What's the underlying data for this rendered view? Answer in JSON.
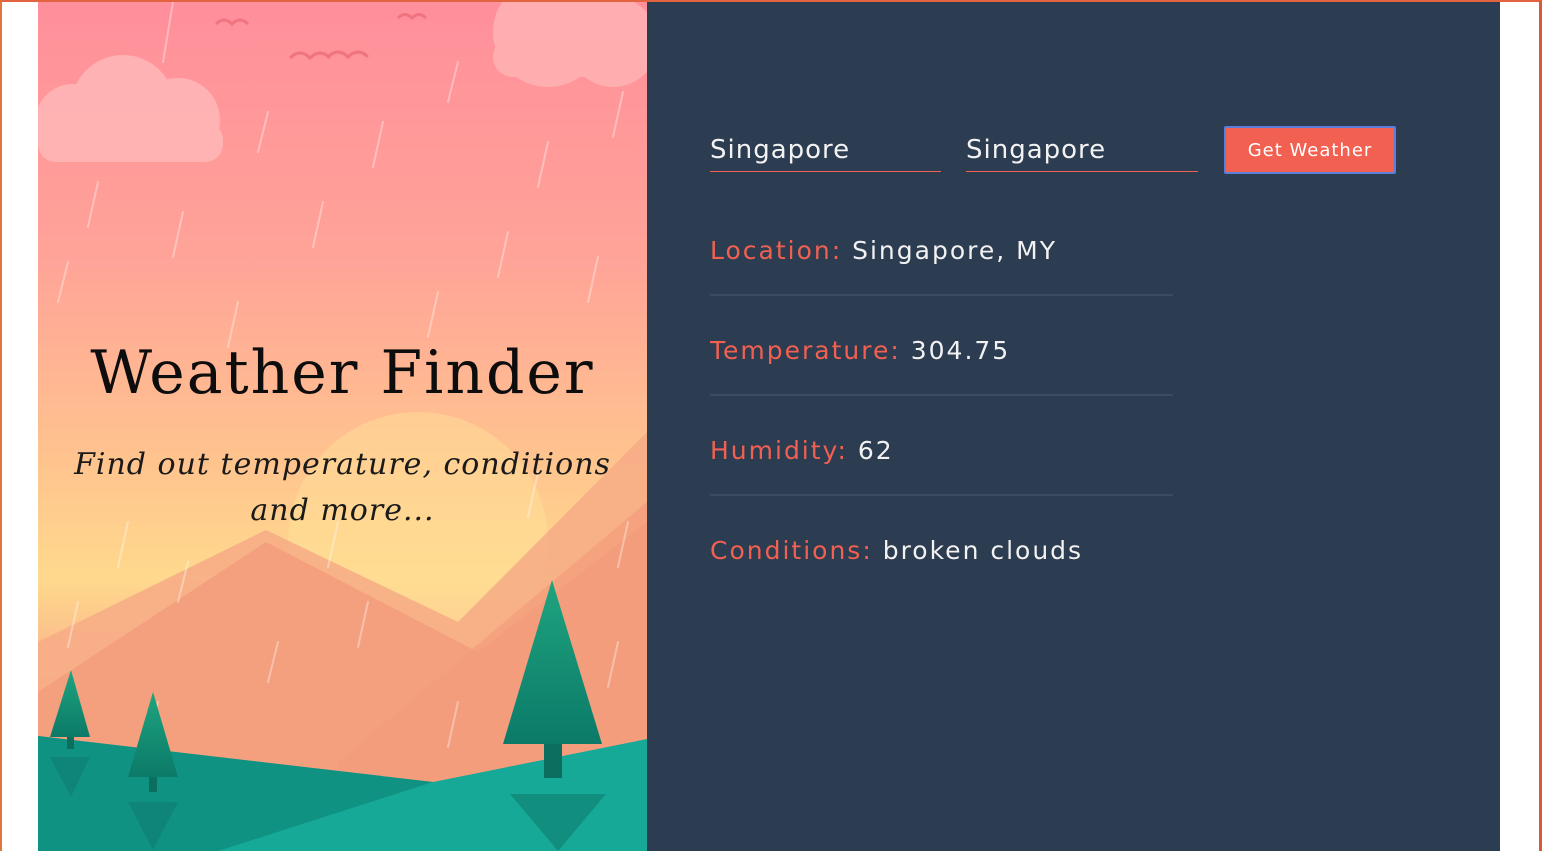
{
  "hero": {
    "title": "Weather Finder",
    "subtitle": "Find out temperature, conditions and more..."
  },
  "form": {
    "city_value": "Singapore",
    "country_value": "Singapore",
    "submit_label": "Get Weather"
  },
  "results": [
    {
      "label": "Location:",
      "value": "Singapore, MY"
    },
    {
      "label": "Temperature:",
      "value": "304.75"
    },
    {
      "label": "Humidity:",
      "value": "62"
    },
    {
      "label": "Conditions:",
      "value": "broken clouds"
    }
  ],
  "colors": {
    "accent": "#f16051",
    "panel_background": "#2c3c51",
    "text_light": "#f2f2f2"
  }
}
